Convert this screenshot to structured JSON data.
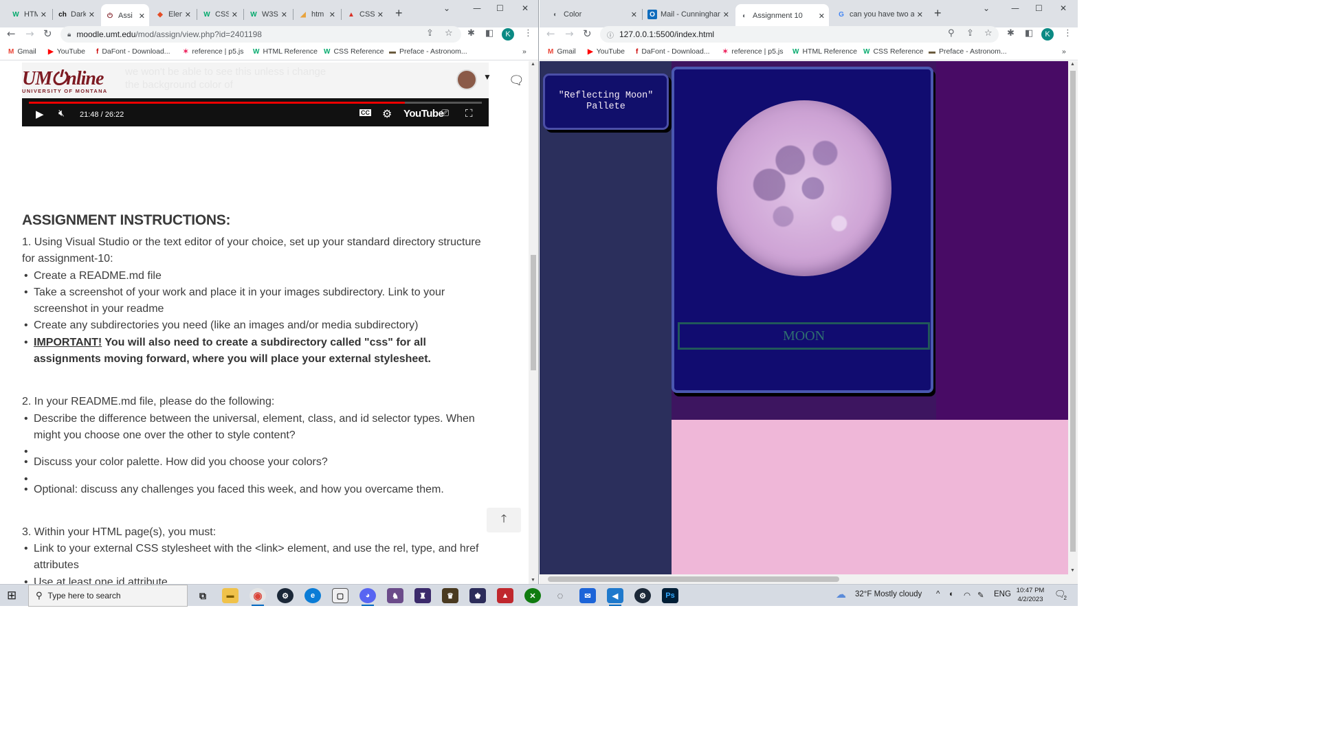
{
  "left": {
    "tabs": [
      {
        "icon": "W",
        "label": "HTML"
      },
      {
        "icon": "ch",
        "label": "Dark"
      },
      {
        "icon": "⏻",
        "label": "Assi"
      },
      {
        "icon": "◆",
        "label": "Elem"
      },
      {
        "icon": "W",
        "label": "CSS"
      },
      {
        "icon": "W",
        "label": "W3S"
      },
      {
        "icon": "◢",
        "label": "htm"
      },
      {
        "icon": "▲",
        "label": "CSS"
      }
    ],
    "url_host": "moodle.umt.edu",
    "url_path": "/mod/assign/view.php?id=2401198",
    "video": {
      "logo": "UM⏻nline",
      "logo_sub": "UNIVERSITY OF MONTANA",
      "overlay_text": "we won't be able to see this unless i change the background color of",
      "time": "21:48 / 26:22",
      "progress": 0.83,
      "brand": "YouTube"
    },
    "instructions": {
      "heading": "ASSIGNMENT INSTRUCTIONS:",
      "s1_intro": "1. Using Visual Studio or the text editor of your choice, set up your standard directory structure for assignment-10:",
      "s1_items": [
        "Create a README.md file",
        "Take a screenshot of your work and place it in your images subdirectory. Link to your screenshot in your readme",
        "Create any subdirectories you need (like an images and/or media subdirectory)"
      ],
      "s1_important": "IMPORTANT!",
      "s1_important_rest": " You will also need to create a subdirectory called \"css\" for all assignments moving forward, where you will place your external stylesheet.",
      "s2_intro": "2. In your README.md file, please do the following:",
      "s2_items": [
        "Describe the difference between the universal, element, class, and id selector types. When might you choose one over the other to style content?",
        "Discuss your color palette. How did you choose your colors?",
        "Optional: discuss any challenges you faced this week, and how you overcame them."
      ],
      "s3_intro": "3. Within your HTML page(s), you must:",
      "s3_items": [
        "Link to your external CSS stylesheet with the <link> element, and use the rel, type, and href attributes",
        "Use at least one id attribute"
      ]
    }
  },
  "right": {
    "tabs": [
      {
        "icon": "◐",
        "label": "Color"
      },
      {
        "icon": "O",
        "label": "Mail - Cunningham"
      },
      {
        "icon": "◐",
        "label": "Assignment 10"
      },
      {
        "icon": "G",
        "label": "can you have two a"
      }
    ],
    "url": "127.0.0.1:5500/index.html",
    "page": {
      "palette_title": "\"Reflecting Moon\" Pallete",
      "moon_label": "MOON"
    },
    "colors": {
      "sidebar": "#2b2f5c",
      "card": "#110c70",
      "card_border": "#4a58b0",
      "strip": "#480b65",
      "pink": "#efb7d8"
    }
  },
  "bookmarks": [
    {
      "icon": "M",
      "label": "Gmail"
    },
    {
      "icon": "▶",
      "label": "YouTube"
    },
    {
      "icon": "f",
      "label": "DaFont - Download..."
    },
    {
      "icon": "✶",
      "label": "reference | p5.js"
    },
    {
      "icon": "W",
      "label": "HTML Reference"
    },
    {
      "icon": "W",
      "label": "CSS Reference"
    },
    {
      "icon": "▬",
      "label": "Preface - Astronom..."
    }
  ],
  "profile_initial": "K",
  "taskbar": {
    "search_placeholder": "Type here to search",
    "weather": "32°F  Mostly cloudy",
    "lang": "ENG",
    "time": "10:47 PM",
    "date": "4/2/2023",
    "notifications": "2"
  }
}
